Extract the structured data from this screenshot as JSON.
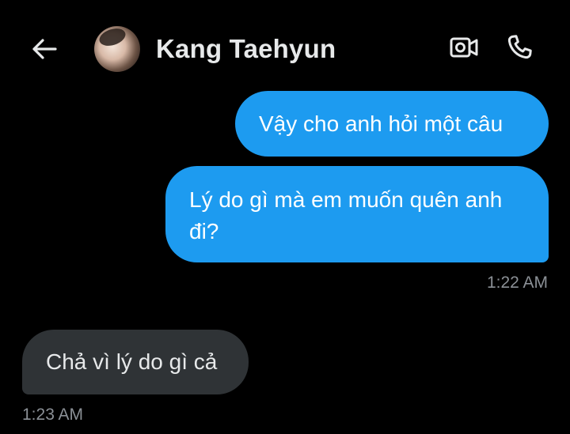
{
  "header": {
    "contact_name": "Kang Taehyun",
    "icons": [
      "back-arrow-icon",
      "video-camera-icon",
      "phone-icon"
    ]
  },
  "messages": [
    {
      "direction": "outgoing",
      "text": "Vậy cho anh hỏi một câu"
    },
    {
      "direction": "outgoing",
      "text_line1": "Lý do gì mà em muốn quên anh",
      "text_line2": "đi?"
    },
    {
      "direction": "incoming",
      "text": "Chả vì lý do gì cả"
    }
  ],
  "timestamps": {
    "outgoing": "1:22 AM",
    "incoming": "1:23 AM"
  },
  "colors": {
    "background": "#000000",
    "outgoing_bubble": "#1d9bf0",
    "incoming_bubble": "#2f3336",
    "text": "#e7e9ea",
    "timestamp": "#8b9096"
  }
}
